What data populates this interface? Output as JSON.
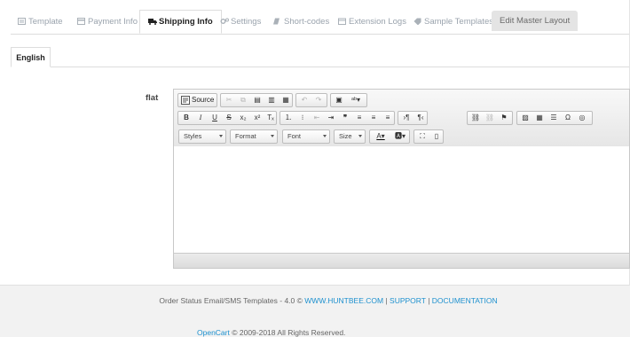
{
  "tabs": [
    {
      "label": "Template",
      "icon": "template-icon"
    },
    {
      "label": "Payment Info",
      "icon": "payment-icon"
    },
    {
      "label": "Shipping Info",
      "icon": "truck-icon",
      "active": true
    },
    {
      "label": "Settings",
      "icon": "gear-icon"
    },
    {
      "label": "Short-codes",
      "icon": "code-icon"
    },
    {
      "label": "Extension Logs",
      "icon": "calendar-icon"
    },
    {
      "label": "Sample Templates",
      "icon": "tag-icon"
    },
    {
      "label": "Edit Master Layout",
      "icon": ""
    }
  ],
  "language_tab": "English",
  "field_label": "flat",
  "editor": {
    "source_label": "Source",
    "combos": {
      "styles": "Styles",
      "format": "Format",
      "font": "Font",
      "size": "Size"
    },
    "content": ""
  },
  "footer": {
    "line1_prefix": "Order Status Email/SMS Templates - 4.0 ©",
    "link_huntbee": "WWW.HUNTBEE.COM",
    "separator": "|",
    "link_support": "SUPPORT",
    "link_documentation": "DOCUMENTATION",
    "opencart_link": "OpenCart",
    "copyright": "© 2009-2018 All Rights Reserved."
  },
  "colors": {
    "link": "#1e91cf",
    "background": "#f2f2f2",
    "panel": "#ffffff"
  }
}
